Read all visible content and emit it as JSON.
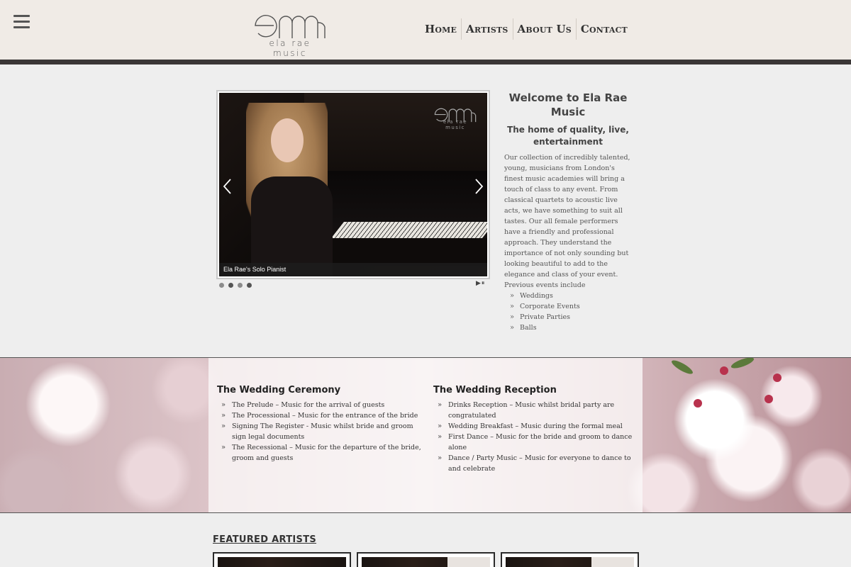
{
  "header": {
    "logo_sub": "ela rae music",
    "nav": [
      {
        "label": "Home"
      },
      {
        "label": "Artists"
      },
      {
        "label": "About Us"
      },
      {
        "label": "Contact"
      }
    ]
  },
  "slider": {
    "caption": "Ela Rae's Solo Pianist",
    "watermark_sub": "ela rae music",
    "slide_count": 4,
    "active_index": 1,
    "controls": "▶⏸"
  },
  "welcome": {
    "title": "Welcome to Ela Rae Music",
    "subtitle": "The home of quality, live, entertainment",
    "body": "Our collection of incredibly talented, young, musicians from London's finest music academies will bring a touch of class to any event. From classical quartets to acoustic live acts, we have something to suit all tastes. Our all female performers have a friendly and professional approach. They understand the importance of not only sounding but looking beautiful to add to the elegance and class of your event. Previous events include",
    "events": [
      "Weddings",
      "Corporate Events",
      "Private Parties",
      "Balls"
    ]
  },
  "wedding": {
    "ceremony": {
      "title": "The Wedding Ceremony",
      "items": [
        "The Prelude – Music for the arrival of guests",
        "The Processional – Music for the entrance of the bride",
        "Signing The Register - Music whilst bride and groom sign legal documents",
        "The Recessional – Music for the departure of the bride, groom and guests"
      ]
    },
    "reception": {
      "title": "The Wedding Reception",
      "items": [
        "Drinks Reception – Music whilst bridal party are congratulated",
        "Wedding Breakfast – Music during the formal meal",
        "First Dance – Music for the bride and groom to dance alone",
        "Dance / Party Music – Music for everyone to dance to and celebrate"
      ]
    }
  },
  "featured": {
    "title": "FEATURED ARTISTS"
  },
  "colors": {
    "header_bg": "#f0ebe6",
    "header_bar": "#3a3636",
    "page_bg": "#eeeeee",
    "text": "#444444"
  }
}
